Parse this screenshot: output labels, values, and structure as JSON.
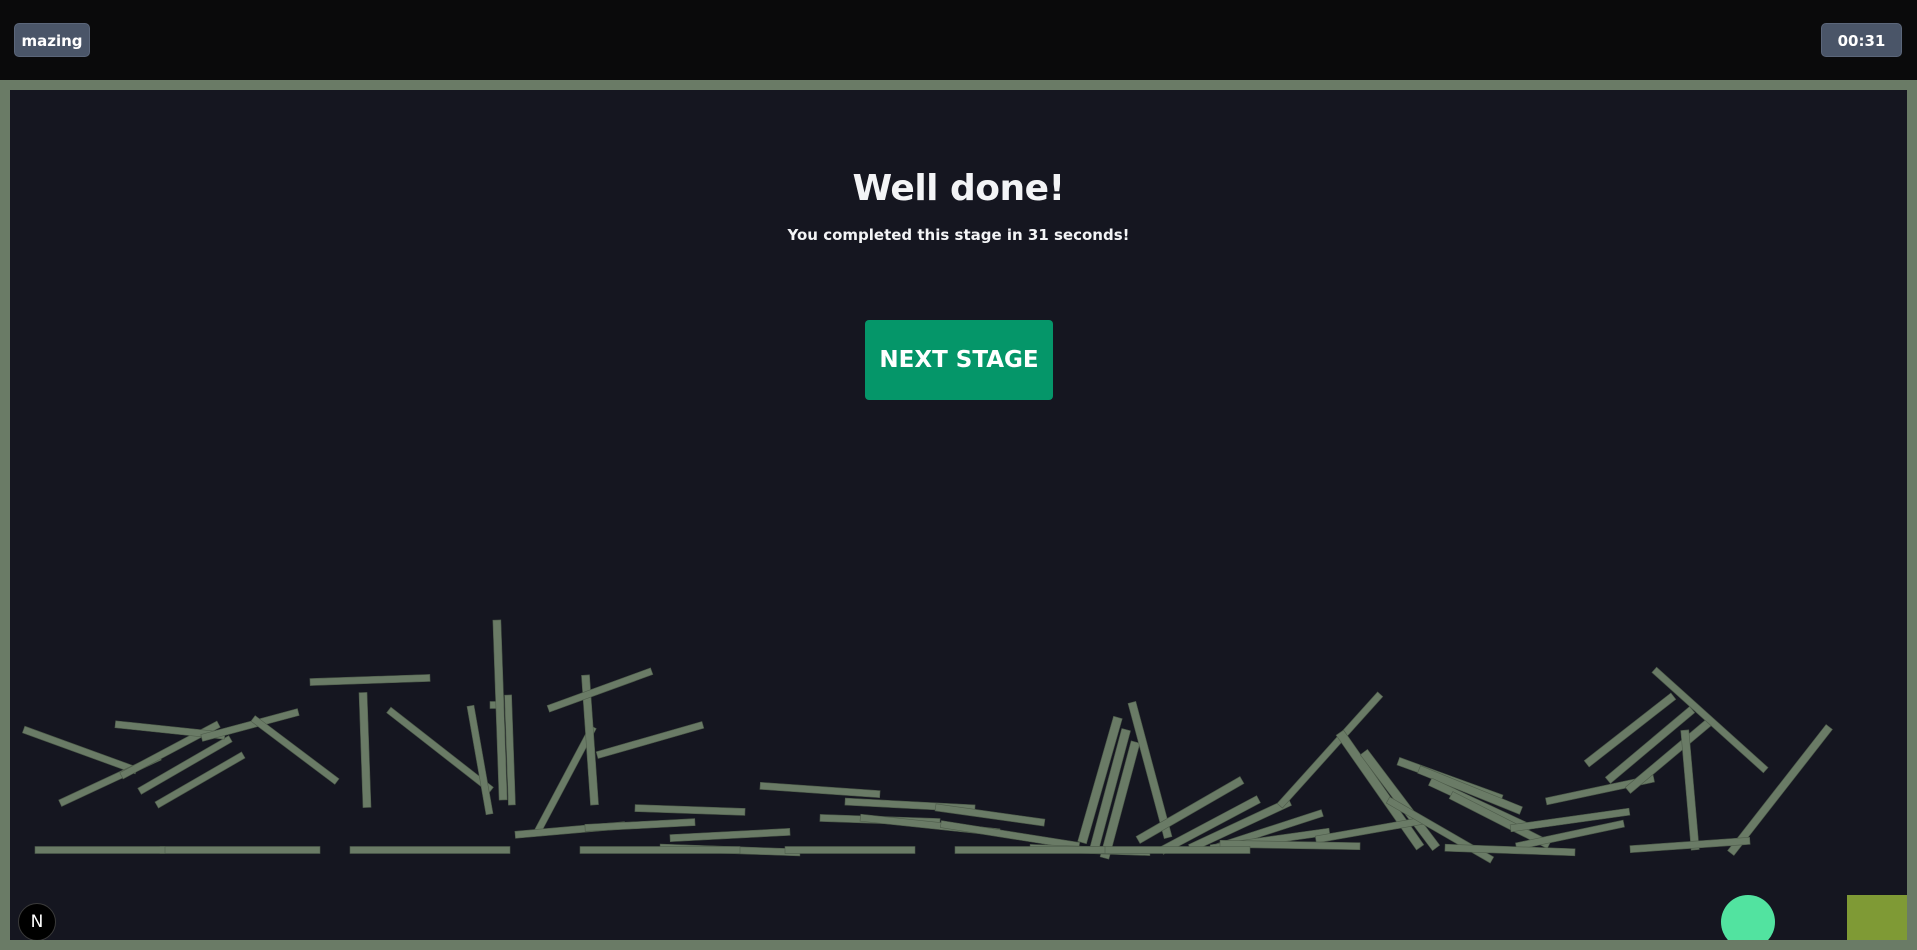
{
  "header": {
    "brand_label": "mazing",
    "timer": "00:31"
  },
  "dialog": {
    "title": "Well done!",
    "message": "You completed this stage in 31 seconds!",
    "next_button_label": "NEXT STAGE"
  },
  "badge": {
    "label": "N"
  },
  "colors": {
    "background": "#151620",
    "frame": "#6a7b66",
    "debris": "#6a7b66",
    "player": "#52e3a0",
    "goal": "#7f9a35",
    "button": "#059669",
    "pill": "#4a5568"
  }
}
